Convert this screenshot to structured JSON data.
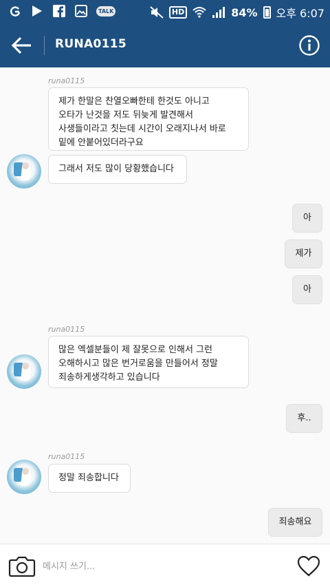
{
  "status_bar": {
    "battery": "84%",
    "time": "오후 6:07",
    "hd": "HD",
    "kakao_label": "TALK"
  },
  "header": {
    "title": "RUNA0115"
  },
  "messages": [
    {
      "sender": "runa0115",
      "direction": "incoming",
      "text": "제가 한말은 찬열오빠한테 한것도 아니고\n오타가 난것을 저도 뒤늦게 발견해서\n사생들이라고 칫는데 시간이 오래지나서 바로\n밑에 안붙어있더라구요"
    },
    {
      "direction": "incoming",
      "text": "그래서 저도 많이 당황했습니다"
    },
    {
      "direction": "outgoing",
      "text": "아"
    },
    {
      "direction": "outgoing",
      "text": "제가"
    },
    {
      "direction": "outgoing",
      "text": "아"
    },
    {
      "sender": "runa0115",
      "direction": "incoming",
      "text": "많은 엑셀분들이 제 잘못으로 인해서 그런\n오해하시고 많은 번거로움을 만들어서 정말\n죄송하게생각하고 있습니다"
    },
    {
      "direction": "outgoing",
      "text": "후.."
    },
    {
      "sender": "runa0115",
      "direction": "incoming",
      "text": "정말 죄송합니다"
    },
    {
      "direction": "outgoing",
      "text": "죄송해요"
    }
  ],
  "composer": {
    "placeholder": "메시지 쓰기..."
  },
  "colors": {
    "header_bg": "#1d4f80",
    "incoming_bubble": "#ffffff",
    "outgoing_bubble": "#ebebeb"
  }
}
